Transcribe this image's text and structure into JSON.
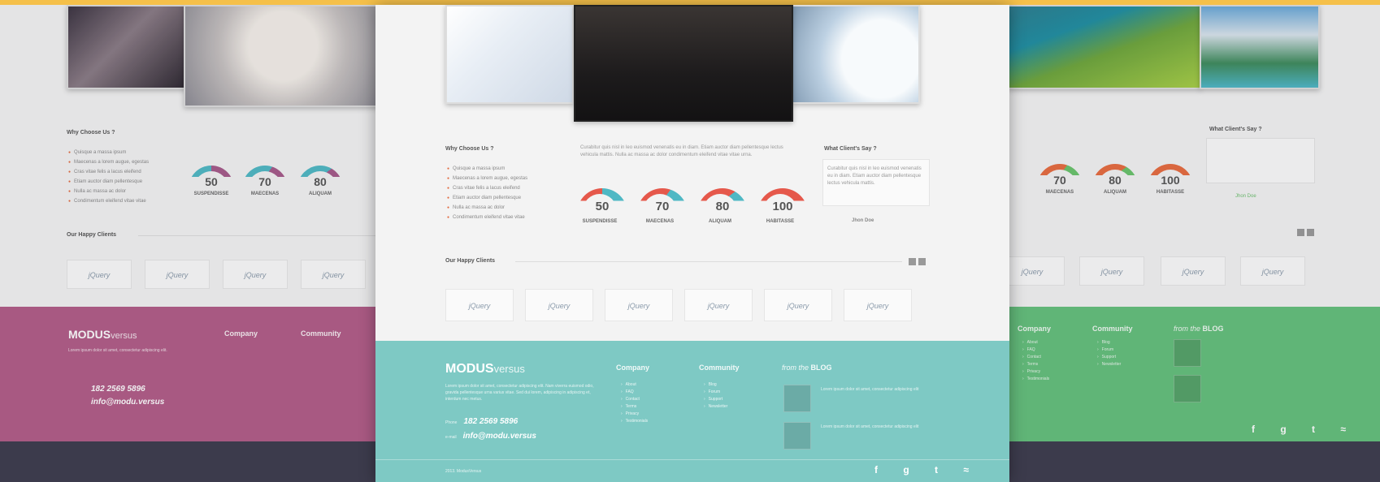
{
  "colors": {
    "accent_top": "#f5c04a",
    "left_footer": "#b25c87",
    "center_footer": "#7ec9c4",
    "right_footer": "#64c07b",
    "gauge_teal": "#4fb8c4",
    "gauge_red": "#e5584b",
    "gauge_green": "#69c36b",
    "gauge_orange": "#e76b3f"
  },
  "left": {
    "why_title": "Why Choose Us ?",
    "clients_title": "Our Happy Clients",
    "gauges": [
      {
        "value": "50",
        "label": "SUSPENDISSE"
      },
      {
        "value": "70",
        "label": "MAECENAS"
      },
      {
        "value": "80",
        "label": "ALIQUAM"
      }
    ],
    "logo": "jQuery",
    "footer": {
      "brand": "MODUS",
      "brand_suffix": "versus",
      "company": "Company",
      "community": "Community",
      "phone": "182 2569 5896",
      "email": "info@modu.versus"
    }
  },
  "center": {
    "why_title": "Why Choose Us ?",
    "clients_say_title": "What Client's Say ?",
    "clients_title": "Our Happy Clients",
    "testimonial_author": "Jhon Doe",
    "bullets": [
      "Quisque a massa ipsum",
      "Maecenas a lorem augue, egestas",
      "Cras vitae felis a lacus eleifend",
      "Etiam auctor diam pellentesque",
      "Nulla ac massa ac dolor",
      "Condimentum eleifend vitae vitae"
    ],
    "gauges": [
      {
        "value": "50",
        "label": "SUSPENDISSE"
      },
      {
        "value": "70",
        "label": "MAECENAS"
      },
      {
        "value": "80",
        "label": "ALIQUAM"
      },
      {
        "value": "100",
        "label": "HABITASSE"
      }
    ],
    "logo": "jQuery",
    "footer": {
      "brand": "MODUS",
      "brand_suffix": "versus",
      "company": "Company",
      "community": "Community",
      "blog_prefix": "from the",
      "blog": "BLOG",
      "phone_label": "Phone",
      "phone": "182 2569 5896",
      "email_label": "e-mail",
      "email": "info@modu.versus",
      "company_links": [
        "About",
        "FAQ",
        "Contact",
        "Terms",
        "Privacy",
        "Testimonials"
      ],
      "community_links": [
        "Blog",
        "Forum",
        "Support",
        "Newsletter"
      ],
      "copyright": "2013. ModusVersus"
    }
  },
  "right": {
    "clients_say_title": "What Client's Say ?",
    "testimonial_author": "Jhon Doe",
    "gauges": [
      {
        "value": "70",
        "label": "MAECENAS"
      },
      {
        "value": "80",
        "label": "ALIQUAM"
      },
      {
        "value": "100",
        "label": "HABITASSE"
      }
    ],
    "logo": "jQuery",
    "footer": {
      "company": "Company",
      "community": "Community",
      "blog_prefix": "from the",
      "blog": "BLOG"
    }
  }
}
